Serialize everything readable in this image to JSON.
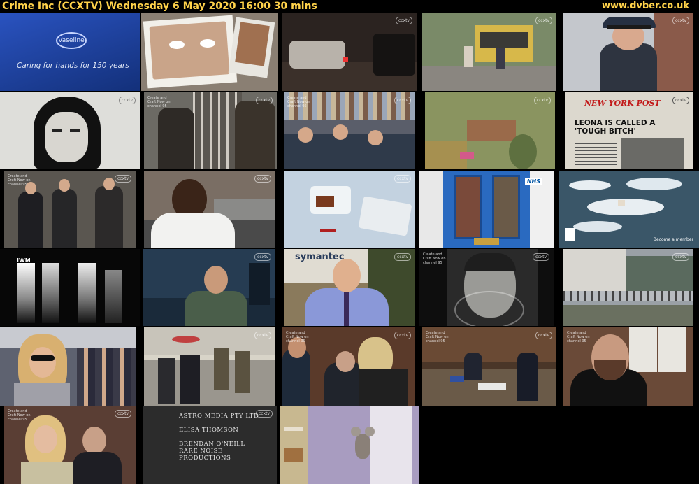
{
  "header": {
    "title": "Crime Inc (CCXTV)   Wednesday 6 May 2020  16:00  30 mins",
    "url": "www.dvber.co.uk"
  },
  "overlays": {
    "watermark": "ccxtv",
    "channel_note": "Create and Craft Now on channel 95",
    "vaseline_logo": "Vaseline",
    "vaseline_slogan": "Caring for hands for 150 years",
    "newspaper_head": "NEW YORK POST",
    "newspaper_line": "LEONA IS CALLED A 'TOUGH BITCH'",
    "wwf_text": "Become a member",
    "iwm": "IWM",
    "nhs": "NHS",
    "symantec": "symantec",
    "credits": [
      "ASTRO MEDIA PTY LTD",
      "ELISA THOMSON",
      "BRENDAN O'NEILL",
      "RARE NOISE PRODUCTIONS"
    ]
  },
  "thumbnails": [
    {
      "name": "vaseline-ad",
      "bg": "#1d3f9a"
    },
    {
      "name": "polaroid-photos",
      "bg": "#8a7f73"
    },
    {
      "name": "night-street-car",
      "bg": "#2b2320"
    },
    {
      "name": "market-kiosk",
      "bg": "#6b7a55"
    },
    {
      "name": "police-officer",
      "bg": "#3d4a5e"
    },
    {
      "name": "sketch-portrait",
      "bg": "#d9d9d6"
    },
    {
      "name": "prison-bars-men",
      "bg": "#55524c"
    },
    {
      "name": "crowded-cell",
      "bg": "#4d5a6e"
    },
    {
      "name": "aerial-estate",
      "bg": "#7f8a55"
    },
    {
      "name": "newspaper-clipping",
      "bg": "#d6d2c8"
    },
    {
      "name": "men-in-suits-walking",
      "bg": "#3a3630"
    },
    {
      "name": "man-white-tshirt",
      "bg": "#6e6258"
    },
    {
      "name": "device-on-table",
      "bg": "#b9c9d8"
    },
    {
      "name": "blue-door",
      "bg": "#2c6bb8"
    },
    {
      "name": "polar-bear-ice",
      "bg": "#3c5566"
    },
    {
      "name": "iwm-lights",
      "bg": "#0a0a0a"
    },
    {
      "name": "man-at-computer",
      "bg": "#2d3f52"
    },
    {
      "name": "symantec-speaker",
      "bg": "#8c7a5e"
    },
    {
      "name": "black-white-face",
      "bg": "#1c1c1c"
    },
    {
      "name": "prison-yard",
      "bg": "#8a9098"
    },
    {
      "name": "blonde-celebrity",
      "bg": "#6a6e7a"
    },
    {
      "name": "escorted-walkway",
      "bg": "#8f8d85"
    },
    {
      "name": "courtroom-suits",
      "bg": "#5a3a2a"
    },
    {
      "name": "courtroom-table",
      "bg": "#4a3a30"
    },
    {
      "name": "bearded-judge",
      "bg": "#6a4a38"
    },
    {
      "name": "blonde-courtroom",
      "bg": "#5a4038"
    },
    {
      "name": "end-credits",
      "bg": "#2f2f2f"
    },
    {
      "name": "mouse-on-shelf",
      "bg": "#9a8fae"
    }
  ]
}
